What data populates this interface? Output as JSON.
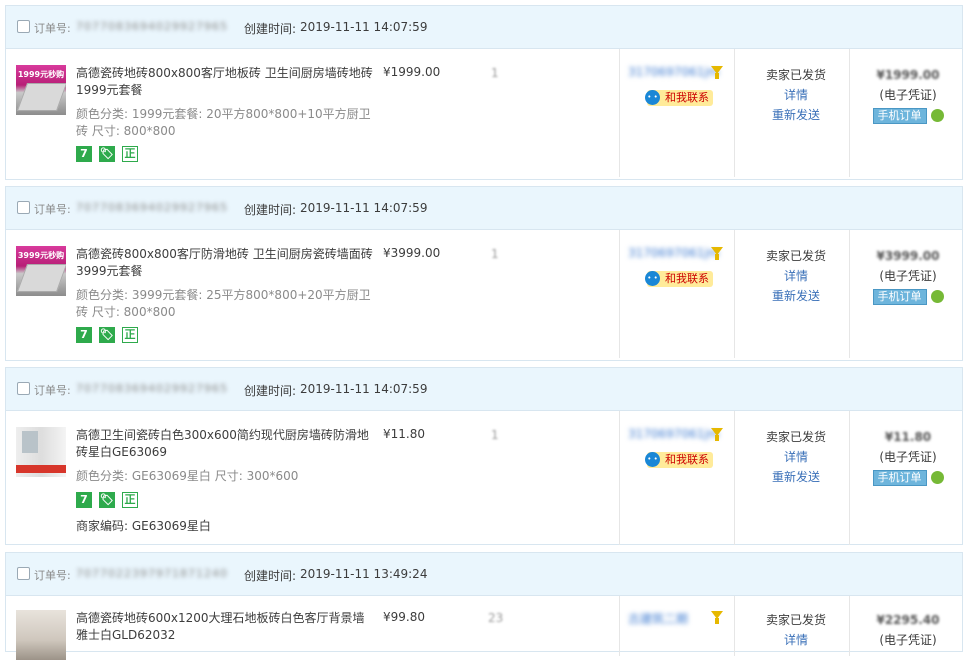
{
  "labels": {
    "order_no": "订单号:",
    "created": "创建时间:",
    "status": "卖家已发货",
    "detail": "详情",
    "resend": "重新发送",
    "voucher": "(电子凭证)",
    "mobile_order": "手机订单",
    "contact": "和我联系",
    "merchant_code": "商家编码:"
  },
  "orders": [
    {
      "order_no": "7077083694029927965",
      "created": "2019-11-11 14:07:59",
      "promo": "1999元秒购",
      "title": "高德瓷砖地砖800x800客厅地板砖 卫生间厨房墙砖地砖1999元套餐",
      "sku": "颜色分类:  1999元套餐:  20平方800*800+10平方厨卫砖   尺寸:  800*800",
      "price": "¥1999.00",
      "qty": "1",
      "buyer": "3170697061jm",
      "total": "¥1999.00",
      "badges": [
        "7",
        "🏷",
        "正"
      ]
    },
    {
      "order_no": "7077083694029927965",
      "created": "2019-11-11 14:07:59",
      "promo": "3999元秒购",
      "title": "高德瓷砖800x800客厅防滑地砖 卫生间厨房瓷砖墙面砖3999元套餐",
      "sku": "颜色分类:  3999元套餐:  25平方800*800+20平方厨卫砖   尺寸:  800*800",
      "price": "¥3999.00",
      "qty": "1",
      "buyer": "3170697061jm",
      "total": "¥3999.00",
      "badges": [
        "7",
        "🏷",
        "正"
      ]
    },
    {
      "order_no": "7077083694029927965",
      "created": "2019-11-11 14:07:59",
      "title": "高德卫生间瓷砖白色300x600简约现代厨房墙砖防滑地砖星白GE63069",
      "sku": "颜色分类:  GE63069星白   尺寸:  300*600",
      "price": "¥11.80",
      "qty": "1",
      "buyer": "3170697061jm",
      "total": "¥11.80",
      "merchant_code": "GE63069星白",
      "badges": [
        "7",
        "🏷",
        "正"
      ]
    },
    {
      "order_no": "7077022397971871240",
      "created": "2019-11-11 13:49:24",
      "title": "高德瓷砖地砖600x1200大理石地板砖白色客厅背景墙雅士白GLD62032",
      "price": "¥99.80",
      "qty": "23",
      "buyer": "古建筑二期",
      "total": "¥2295.40"
    }
  ]
}
